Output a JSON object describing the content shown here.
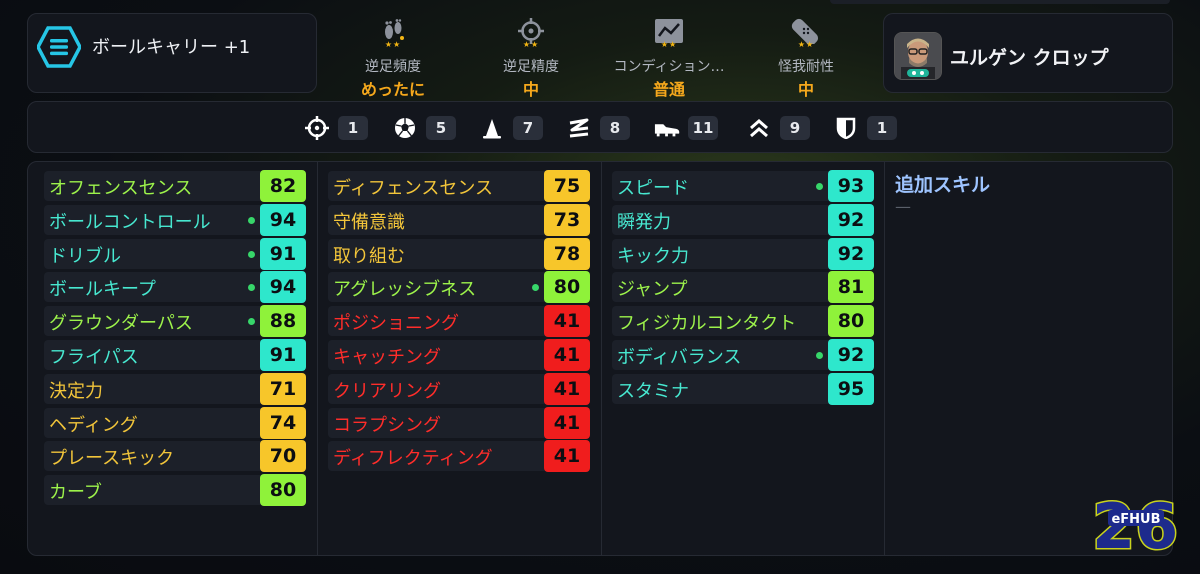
{
  "skill": {
    "name": "ボールキャリー +1",
    "icon": "ball-carry-icon",
    "accent": "#26c6e6"
  },
  "attributes": [
    {
      "id": "weak-foot-usage",
      "icon": "footprints-icon",
      "stars": "★★",
      "label": "逆足頻度",
      "value": "めったに"
    },
    {
      "id": "weak-foot-accuracy",
      "icon": "crosshair-icon",
      "stars": "★★",
      "label": "逆足精度",
      "value": "中"
    },
    {
      "id": "form",
      "icon": "condition-chart-icon",
      "stars": "★★",
      "label": "コンディション…",
      "value": "普通"
    },
    {
      "id": "injury-resistance",
      "icon": "bandage-icon",
      "stars": "★★",
      "label": "怪我耐性",
      "value": "中"
    }
  ],
  "manager": {
    "name": "ユルゲン クロップ",
    "avatar": "manager-portrait"
  },
  "positions": [
    {
      "icon": "crosshair-icon",
      "value": "1"
    },
    {
      "icon": "football-icon",
      "value": "5"
    },
    {
      "icon": "cone-icon",
      "value": "7"
    },
    {
      "icon": "zigzag-pass-icon",
      "value": "8"
    },
    {
      "icon": "boot-icon",
      "value": "11"
    },
    {
      "icon": "double-chevron-up-icon",
      "value": "9"
    },
    {
      "icon": "shield-icon",
      "value": "1"
    }
  ],
  "stats": {
    "col1": [
      {
        "name": "オフェンスセンス",
        "value": "82",
        "tone": "green",
        "dot": false
      },
      {
        "name": "ボールコントロール",
        "value": "94",
        "tone": "teal",
        "dot": true
      },
      {
        "name": "ドリブル",
        "value": "91",
        "tone": "teal",
        "dot": true
      },
      {
        "name": "ボールキープ",
        "value": "94",
        "tone": "teal",
        "dot": true
      },
      {
        "name": "グラウンダーパス",
        "value": "88",
        "tone": "green",
        "dot": true
      },
      {
        "name": "フライパス",
        "value": "91",
        "tone": "teal",
        "dot": false
      },
      {
        "name": "決定力",
        "value": "71",
        "tone": "yellow",
        "dot": false
      },
      {
        "name": "ヘディング",
        "value": "74",
        "tone": "yellow",
        "dot": false
      },
      {
        "name": "プレースキック",
        "value": "70",
        "tone": "yellow",
        "dot": false
      },
      {
        "name": "カーブ",
        "value": "80",
        "tone": "green",
        "dot": false
      }
    ],
    "col2": [
      {
        "name": "ディフェンスセンス",
        "value": "75",
        "tone": "yellow",
        "dot": false
      },
      {
        "name": "守備意識",
        "value": "73",
        "tone": "yellow",
        "dot": false
      },
      {
        "name": "取り組む",
        "value": "78",
        "tone": "yellow",
        "dot": false
      },
      {
        "name": "アグレッシブネス",
        "value": "80",
        "tone": "green",
        "dot": true
      },
      {
        "name": "ポジショニング",
        "value": "41",
        "tone": "red",
        "dot": false
      },
      {
        "name": "キャッチング",
        "value": "41",
        "tone": "red",
        "dot": false
      },
      {
        "name": "クリアリング",
        "value": "41",
        "tone": "red",
        "dot": false
      },
      {
        "name": "コラプシング",
        "value": "41",
        "tone": "red",
        "dot": false
      },
      {
        "name": "ディフレクティング",
        "value": "41",
        "tone": "red",
        "dot": false
      }
    ],
    "col3": [
      {
        "name": "スピード",
        "value": "93",
        "tone": "teal",
        "dot": true
      },
      {
        "name": "瞬発力",
        "value": "92",
        "tone": "teal",
        "dot": false
      },
      {
        "name": "キック力",
        "value": "92",
        "tone": "teal",
        "dot": false
      },
      {
        "name": "ジャンプ",
        "value": "81",
        "tone": "green",
        "dot": false
      },
      {
        "name": "フィジカルコンタクト",
        "value": "80",
        "tone": "green",
        "dot": false
      },
      {
        "name": "ボディバランス",
        "value": "92",
        "tone": "teal",
        "dot": true
      },
      {
        "name": "スタミナ",
        "value": "95",
        "tone": "teal",
        "dot": false
      }
    ]
  },
  "extra_skills": {
    "title": "追加スキル",
    "value": "—"
  },
  "logo": {
    "number": "26",
    "text": "eFHUB"
  },
  "colors": {
    "teal": "#2ee7cc",
    "green": "#8ff23a",
    "yellow": "#f7c62a",
    "red": "#f01d1d",
    "accent_orange": "#f5a81c"
  }
}
